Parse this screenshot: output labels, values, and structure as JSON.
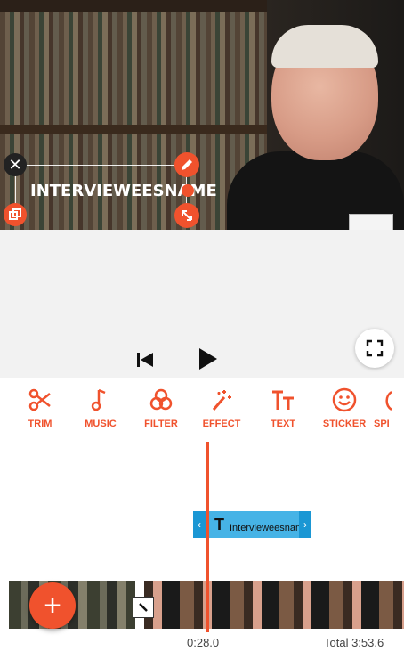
{
  "overlay": {
    "text": "INTERVIEWEESNAME"
  },
  "toolbar": {
    "items": [
      {
        "label": "TRIM",
        "icon": "scissors-icon"
      },
      {
        "label": "MUSIC",
        "icon": "music-note-icon"
      },
      {
        "label": "FILTER",
        "icon": "filter-circles-icon"
      },
      {
        "label": "EFFECT",
        "icon": "magic-wand-icon"
      },
      {
        "label": "TEXT",
        "icon": "text-tt-icon"
      },
      {
        "label": "STICKER",
        "icon": "smiley-icon"
      },
      {
        "label": "SPI",
        "icon": "speed-icon"
      }
    ]
  },
  "timeline": {
    "text_clip_label": "Intervieweesname",
    "text_clip_icon": "T",
    "current_time": "0:28.0",
    "total_time": "Total 3:53.6"
  },
  "colors": {
    "accent": "#f0522d",
    "clip": "#46b3e6",
    "clip_handle": "#1b97d4"
  }
}
